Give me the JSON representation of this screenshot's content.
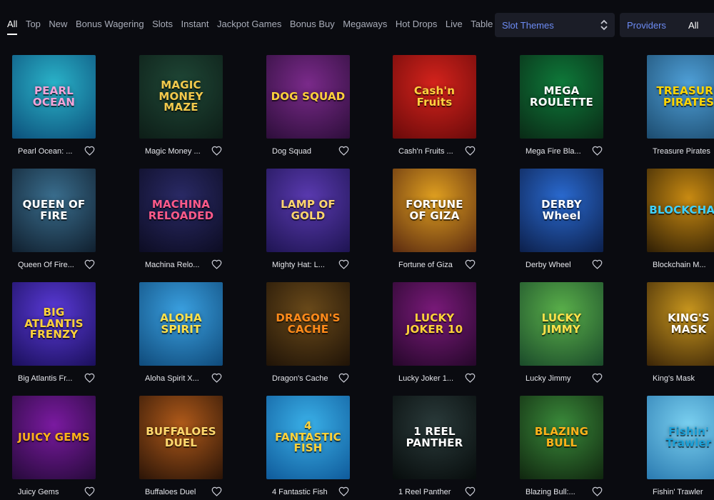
{
  "nav": {
    "tabs": [
      {
        "label": "All",
        "active": true
      },
      {
        "label": "Top"
      },
      {
        "label": "New"
      },
      {
        "label": "Bonus Wagering"
      },
      {
        "label": "Slots"
      },
      {
        "label": "Instant"
      },
      {
        "label": "Jackpot Games"
      },
      {
        "label": "Bonus Buy"
      },
      {
        "label": "Megaways"
      },
      {
        "label": "Hot Drops"
      },
      {
        "label": "Live"
      },
      {
        "label": "Table"
      }
    ],
    "slot_themes": {
      "label": "Slot Themes"
    },
    "providers": {
      "label": "Providers",
      "value": "All"
    }
  },
  "colors": {
    "accent": "#6d8cf5",
    "background": "#0a0b10",
    "select_bg": "#1b1d27"
  },
  "games": [
    {
      "name": "Pearl Ocean: ...",
      "art": "PEARL OCEAN",
      "bg1": "#2ab3c9",
      "bg2": "#0c4f7a",
      "fg": "#f5a3d8"
    },
    {
      "name": "Magic Money ...",
      "art": "MAGIC MONEY MAZE",
      "bg1": "#1f4736",
      "bg2": "#0d1d17",
      "fg": "#f2c94c"
    },
    {
      "name": "Dog Squad",
      "art": "DOG SQUAD",
      "bg1": "#7a2a8a",
      "bg2": "#2d0e3a",
      "fg": "#ffd13b"
    },
    {
      "name": "Cash'n Fruits ...",
      "art": "Cash'n Fruits",
      "bg1": "#d4231c",
      "bg2": "#6a0a0a",
      "fg": "#ffd23f"
    },
    {
      "name": "Mega Fire Bla...",
      "art": "MEGA ROULETTE",
      "bg1": "#0e7a3a",
      "bg2": "#0a2a16",
      "fg": "#ffffff"
    },
    {
      "name": "Treasure Pirates",
      "art": "TREASURE PIRATES",
      "bg1": "#4fa0d8",
      "bg2": "#1c4b6e",
      "fg": "#ffd400"
    },
    {
      "name": "Queen Of Fire...",
      "art": "QUEEN OF FIRE",
      "bg1": "#3a6e8e",
      "bg2": "#101f2e",
      "fg": "#ffffff"
    },
    {
      "name": "Machina Relo...",
      "art": "MACHINA RELOADED",
      "bg1": "#2a2a66",
      "bg2": "#0c0c22",
      "fg": "#ff5a8a"
    },
    {
      "name": "Mighty Hat: L...",
      "art": "LAMP OF GOLD",
      "bg1": "#5a3ab0",
      "bg2": "#1e1452",
      "fg": "#ffd66e"
    },
    {
      "name": "Fortune of Giza",
      "art": "FORTUNE OF GIZA",
      "bg1": "#e0a020",
      "bg2": "#5a2a10",
      "fg": "#ffffff"
    },
    {
      "name": "Derby Wheel",
      "art": "DERBY Wheel",
      "bg1": "#2a6ad0",
      "bg2": "#0c1f4a",
      "fg": "#ffffff"
    },
    {
      "name": "Blockchain M...",
      "art": "BLOCKCHAIN",
      "bg1": "#c88a12",
      "bg2": "#2e1e05",
      "fg": "#3fd1ff"
    },
    {
      "name": "Big Atlantis Fr...",
      "art": "BIG ATLANTIS FRENZY",
      "bg1": "#5a3ad8",
      "bg2": "#1a0f5a",
      "fg": "#ffd23a"
    },
    {
      "name": "Aloha Spirit X...",
      "art": "ALOHA SPIRIT",
      "bg1": "#3aa0e0",
      "bg2": "#0f4a7a",
      "fg": "#ffe14a"
    },
    {
      "name": "Dragon's Cache",
      "art": "DRAGON'S CACHE",
      "bg1": "#6a4a1a",
      "bg2": "#1f1307",
      "fg": "#ff8a1a"
    },
    {
      "name": "Lucky Joker 1...",
      "art": "LUCKY JOKER 10",
      "bg1": "#7a1a7a",
      "bg2": "#25072a",
      "fg": "#ffd23a"
    },
    {
      "name": "Lucky Jimmy",
      "art": "LUCKY JIMMY",
      "bg1": "#5ab04a",
      "bg2": "#1a4a2a",
      "fg": "#ffe14a"
    },
    {
      "name": "King's Mask",
      "art": "KING'S MASK",
      "bg1": "#c8961e",
      "bg2": "#3a2407",
      "fg": "#ffffff"
    },
    {
      "name": "Juicy Gems",
      "art": "JUICY GEMS",
      "bg1": "#7a1aa0",
      "bg2": "#260a3a",
      "fg": "#ffb21a"
    },
    {
      "name": "Buffaloes Duel",
      "art": "BUFFALOES DUEL",
      "bg1": "#b05a1a",
      "bg2": "#2a1407",
      "fg": "#ffd96e"
    },
    {
      "name": "4 Fantastic Fish",
      "art": "4 FANTASTIC FISH",
      "bg1": "#3ab0e8",
      "bg2": "#0f5a9a",
      "fg": "#ffd23a"
    },
    {
      "name": "1 Reel Panther",
      "art": "1 REEL PANTHER",
      "bg1": "#2a3a3a",
      "bg2": "#070c0c",
      "fg": "#ffffff"
    },
    {
      "name": "Blazing Bull:...",
      "art": "BLAZING BULL",
      "bg1": "#3a8a3a",
      "bg2": "#10260f",
      "fg": "#ffb21a"
    },
    {
      "name": "Fishin' Trawler",
      "art": "Fishin' Trawler",
      "bg1": "#7ad0f0",
      "bg2": "#2a7ab0",
      "fg": "#1aa0d8"
    }
  ]
}
